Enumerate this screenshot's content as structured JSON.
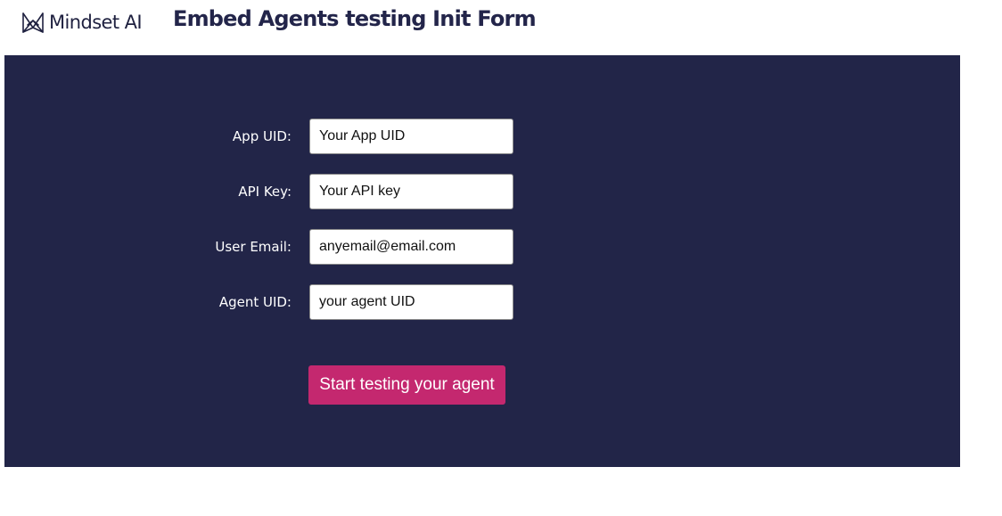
{
  "header": {
    "logo_text": "Mindset AI",
    "logo_icon": "mindset-ai-logo-icon",
    "title": "Embed Agents testing Init Form"
  },
  "form": {
    "fields": [
      {
        "label": "App UID:",
        "value": "Your App UID"
      },
      {
        "label": "API Key:",
        "value": "Your API key"
      },
      {
        "label": "User Email:",
        "value": "anyemail@email.com"
      },
      {
        "label": "Agent UID:",
        "value": "your agent UID"
      }
    ],
    "submit_label": "Start testing your agent"
  },
  "colors": {
    "panel_background": "#222548",
    "button_background": "#c4286f",
    "title_color": "#23254a"
  }
}
